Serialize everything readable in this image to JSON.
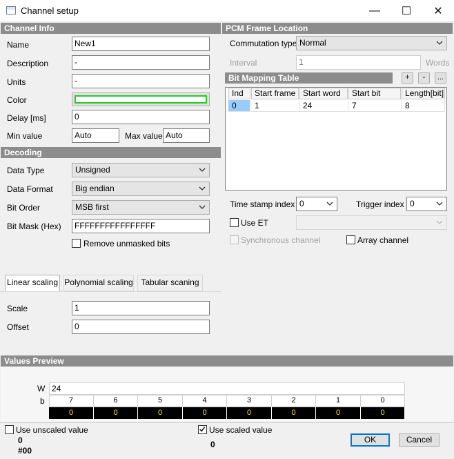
{
  "window": {
    "title": "Channel setup",
    "minimize_glyph": "—",
    "maximize_glyph": "☐",
    "close_glyph": "✕"
  },
  "channel_info": {
    "header": "Channel Info",
    "name_label": "Name",
    "name_value": "New1",
    "description_label": "Description",
    "description_value": "-",
    "units_label": "Units",
    "units_value": "-",
    "color_label": "Color",
    "color_value": "#22cc22",
    "delay_label": "Delay [ms]",
    "delay_value": "0",
    "min_label": "Min value",
    "min_value": "Auto",
    "max_label": "Max value",
    "max_value": "Auto"
  },
  "decoding": {
    "header": "Decoding",
    "data_type_label": "Data Type",
    "data_type_value": "Unsigned",
    "data_format_label": "Data Format",
    "data_format_value": "Big endian",
    "bit_order_label": "Bit Order",
    "bit_order_value": "MSB first",
    "bit_mask_label": "Bit Mask (Hex)",
    "bit_mask_value": "FFFFFFFFFFFFFFFF",
    "remove_unmasked_label": "Remove unmasked bits"
  },
  "scaling": {
    "tabs": [
      {
        "label": "Linear scaling"
      },
      {
        "label": "Polynomial scaling"
      },
      {
        "label": "Tabular scaning"
      }
    ],
    "scale_label": "Scale",
    "scale_value": "1",
    "offset_label": "Offset",
    "offset_value": "0"
  },
  "pcm": {
    "header": "PCM Frame Location",
    "commutation_label": "Commutation type",
    "commutation_value": "Normal",
    "interval_label": "Interval",
    "interval_value": "1",
    "interval_unit": "Words",
    "bit_mapping_header": "Bit Mapping Table",
    "add_label": "+",
    "remove_label": "-",
    "more_label": "...",
    "table": {
      "columns": [
        "Ind",
        "Start frame",
        "Start word",
        "Start bit",
        "Length[bit]"
      ],
      "rows": [
        [
          "0",
          "1",
          "24",
          "7",
          "8"
        ]
      ]
    },
    "timestamp_label": "Time stamp index",
    "timestamp_value": "0",
    "trigger_label": "Trigger index",
    "trigger_value": "0",
    "use_et_label": "Use ET",
    "synchronous_label": "Synchronous channel",
    "array_label": "Array channel"
  },
  "preview": {
    "header": "Values Preview",
    "w_label": "W",
    "w_value": "24",
    "b_label": "b",
    "bits": [
      "7",
      "6",
      "5",
      "4",
      "3",
      "2",
      "1",
      "0"
    ],
    "bit_values": [
      "0",
      "0",
      "0",
      "0",
      "0",
      "0",
      "0",
      "0"
    ]
  },
  "footer": {
    "unscaled_label": "Use unscaled value",
    "unscaled_value": "0",
    "unscaled_hex": "#00",
    "scaled_label": "Use scaled value",
    "scaled_value": "0",
    "ok_label": "OK",
    "cancel_label": "Cancel"
  }
}
